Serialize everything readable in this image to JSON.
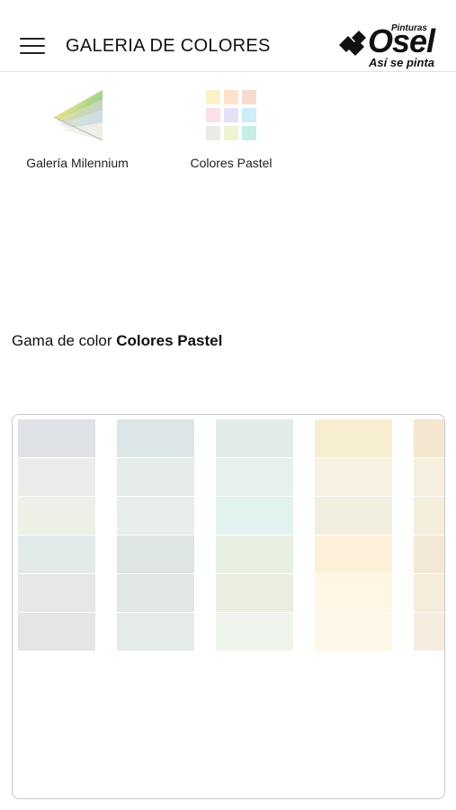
{
  "header": {
    "title": "GALERIA DE COLORES",
    "menu_icon": "hamburger-menu-icon",
    "logo": {
      "brand": "Osel",
      "small_text": "Pinturas",
      "tagline": "Así se pinta"
    }
  },
  "gallery": [
    {
      "label": "Galería Milennium",
      "icon": "color-fan-deck-icon"
    },
    {
      "label": "Colores Pastel",
      "icon": "pastel-swatch-grid-icon"
    }
  ],
  "gama": {
    "prefix": "Gama de color",
    "name": "Colores Pastel"
  },
  "palette": {
    "columns": [
      {
        "swatches": [
          "#dfe2e6",
          "#e9ece9",
          "#eef0e7",
          "#e3ebea",
          "#e6e7e6",
          "#e5e6e3"
        ]
      },
      {
        "swatches": [
          "#dce6e7",
          "#e6ede8",
          "#e8efea",
          "#dde6e1",
          "#e1e7e2",
          "#e5ebe8"
        ]
      },
      {
        "swatches": [
          "#e1ece7",
          "#e8f0ec",
          "#e2f2ee",
          "#e9efe1",
          "#eaeee0",
          "#eef4eb"
        ]
      },
      {
        "swatches": [
          "#f7edcf",
          "#f7f2e1",
          "#f2efe1",
          "#fdf0d8",
          "#fff6e6",
          "#fff7e8"
        ]
      },
      {
        "swatches": [
          "#f4e6cf",
          "#f4efdf",
          "#f4eedd",
          "#f3e8d6",
          "#f6ecdc",
          "#f6ede0"
        ]
      }
    ]
  },
  "colors": {
    "accent": "#111111",
    "divider": "#e3e3e3",
    "panel_border": "#c9c9c9"
  }
}
